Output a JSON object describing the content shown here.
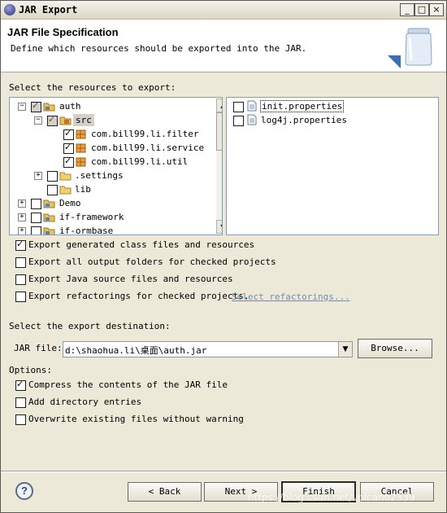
{
  "window": {
    "title": "JAR Export",
    "controls": {
      "minimize": "_",
      "maximize": "□",
      "close": "×"
    }
  },
  "header": {
    "title": "JAR File Specification",
    "description": "Define which resources should be exported into the JAR."
  },
  "resources": {
    "label": "Select the resources to export:",
    "tree": [
      {
        "label": "auth",
        "icon": "project-icon",
        "expanded": true,
        "checked": "partial"
      },
      {
        "label": "src",
        "icon": "source-folder-icon",
        "expanded": true,
        "checked": "partial",
        "selected": true
      },
      {
        "label": "com.bill99.li.filter",
        "icon": "package-icon",
        "checked": "checked"
      },
      {
        "label": "com.bill99.li.service",
        "icon": "package-icon",
        "checked": "checked"
      },
      {
        "label": "com.bill99.li.util",
        "icon": "package-icon",
        "checked": "checked"
      },
      {
        "label": ".settings",
        "icon": "folder-icon",
        "expanded": false,
        "checked": "unchecked"
      },
      {
        "label": "lib",
        "icon": "folder-icon",
        "checked": "unchecked"
      },
      {
        "label": "Demo",
        "icon": "project-icon",
        "expanded": false,
        "checked": "unchecked"
      },
      {
        "label": "if-framework",
        "icon": "project-icon",
        "expanded": false,
        "checked": "unchecked"
      },
      {
        "label": "if-ormbase",
        "icon": "project-icon",
        "expanded": false,
        "checked": "unchecked"
      }
    ],
    "files": [
      {
        "label": "init.properties",
        "icon": "file-icon",
        "checked": false
      },
      {
        "label": "log4j.properties",
        "icon": "file-icon",
        "checked": false
      }
    ]
  },
  "export_options": [
    {
      "label": "Export generated class files and resources",
      "checked": true
    },
    {
      "label": "Export all output folders for checked projects",
      "checked": false
    },
    {
      "label": "Export Java source files and resources",
      "checked": false
    },
    {
      "label": "Export refactorings for checked projects.",
      "checked": false
    }
  ],
  "select_refactorings_link": "Select refactorings...",
  "destination": {
    "label": "Select the export destination:",
    "jar_file_label": "JAR file:",
    "jar_file_value": "d:\\shaohua.li\\桌面\\auth.jar",
    "browse_label": "Browse..."
  },
  "options": {
    "label": "Options:",
    "items": [
      {
        "label": "Compress the contents of the JAR file",
        "checked": true
      },
      {
        "label": "Add directory entries",
        "checked": false
      },
      {
        "label": "Overwrite existing files without warning",
        "checked": false
      }
    ]
  },
  "buttons": {
    "help": "?",
    "back": "< Back",
    "next": "Next >",
    "finish": "Finish",
    "cancel": "Cancel"
  },
  "watermark": "https://blog.csdn.net/volcano2339"
}
